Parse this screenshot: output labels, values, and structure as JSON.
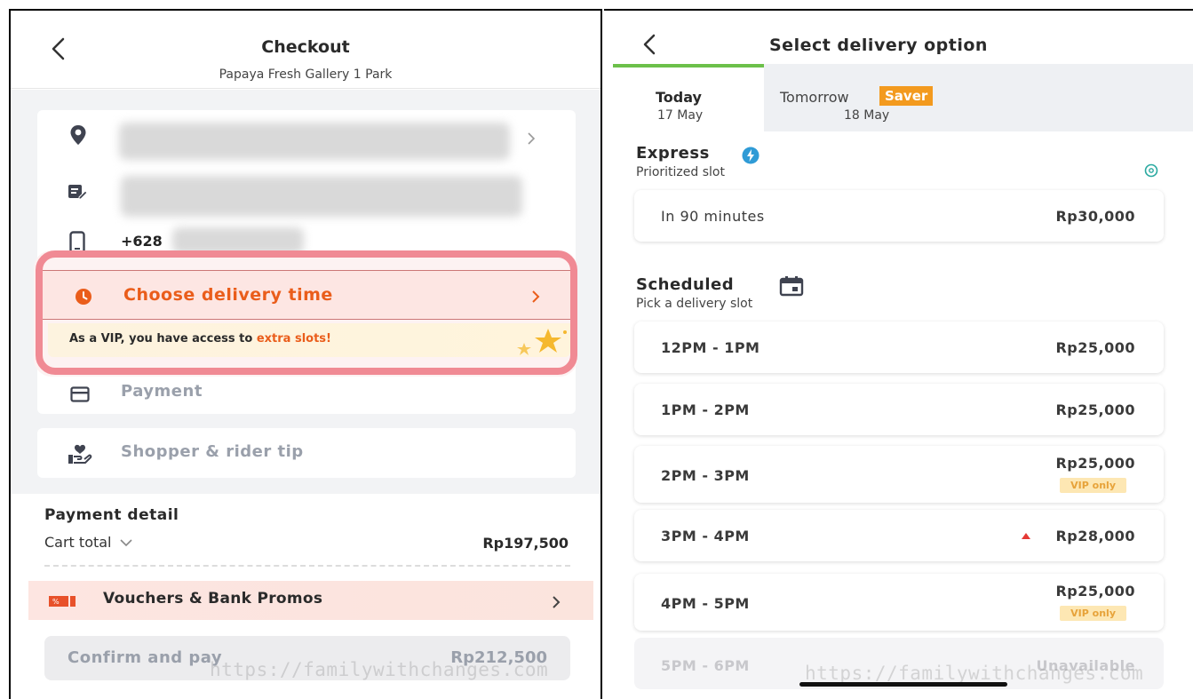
{
  "left": {
    "header": {
      "title": "Checkout",
      "subtitle": "Papaya Fresh Gallery 1 Park"
    },
    "phone_prefix": "+628",
    "delivery": {
      "label": "Choose delivery time"
    },
    "vip_banner": {
      "prefix": "As a VIP, you have access to ",
      "highlight": "extra slots!"
    },
    "payment_label": "Payment",
    "tip_label": "Shopper & rider tip",
    "payment_detail": {
      "heading": "Payment detail",
      "cart_total_label": "Cart total",
      "cart_total_value": "Rp197,500"
    },
    "vouchers_label": "Vouchers & Bank Promos",
    "confirm": {
      "label": "Confirm and pay",
      "amount": "Rp212,500"
    },
    "watermark": "https://familywithchanges.com"
  },
  "right": {
    "header": {
      "title": "Select delivery option"
    },
    "tabs": [
      {
        "label": "Today",
        "date": "17 May"
      },
      {
        "label": "Tomorrow",
        "badge": "Saver",
        "date": "18 May"
      }
    ],
    "express": {
      "title": "Express",
      "subtitle": "Prioritized slot",
      "slot": {
        "time": "In 90 minutes",
        "price": "Rp30,000"
      }
    },
    "scheduled": {
      "title": "Scheduled",
      "subtitle": "Pick a delivery slot",
      "slots": [
        {
          "time": "12PM - 1PM",
          "price": "Rp25,000"
        },
        {
          "time": "1PM - 2PM",
          "price": "Rp25,000"
        },
        {
          "time": "2PM - 3PM",
          "price": "Rp25,000",
          "tag": "VIP only"
        },
        {
          "time": "3PM - 4PM",
          "price": "Rp28,000"
        },
        {
          "time": "4PM - 5PM",
          "price": "Rp25,000",
          "tag": "VIP only"
        },
        {
          "time": "5PM - 6PM",
          "price": "Unavailable"
        }
      ]
    },
    "watermark": "https://familywithchanges.com"
  },
  "colors": {
    "accent_orange": "#ea5d1b",
    "highlight_pink": "#f08a94",
    "tab_green": "#6cc04a",
    "saver_orange": "#f39a1e",
    "express_blue": "#2f9bd6"
  }
}
